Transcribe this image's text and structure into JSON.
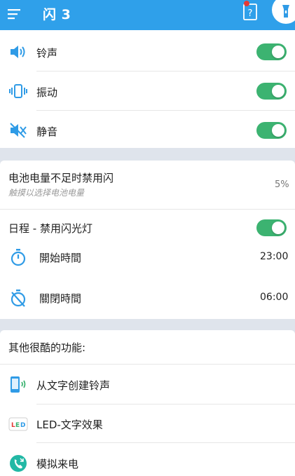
{
  "appbar": {
    "title": "闪 3"
  },
  "sound": {
    "ringtone": {
      "label": "铃声",
      "enabled": true
    },
    "vibrate": {
      "label": "振动",
      "enabled": true
    },
    "silent": {
      "label": "静音",
      "enabled": true
    }
  },
  "battery": {
    "title": "电池电量不足时禁用闪",
    "subtitle": "触摸以选择电池电量",
    "value": "5%"
  },
  "schedule": {
    "title": "日程 - 禁用闪光灯",
    "enabled": true,
    "start": {
      "label": "開始時間",
      "value": "23:00"
    },
    "end": {
      "label": "關閉時間",
      "value": "06:00"
    }
  },
  "features": {
    "title": "其他很酷的功能:",
    "items": [
      {
        "label": "从文字创建铃声",
        "icon": "phone-ringtone-icon"
      },
      {
        "label": "LED-文字效果",
        "icon": "led-icon"
      },
      {
        "label": "模拟来电",
        "icon": "incoming-call-icon"
      }
    ]
  },
  "colors": {
    "appbar": "#2fa0ea",
    "accent": "#3cb371",
    "icon_blue": "#2f9be6"
  }
}
